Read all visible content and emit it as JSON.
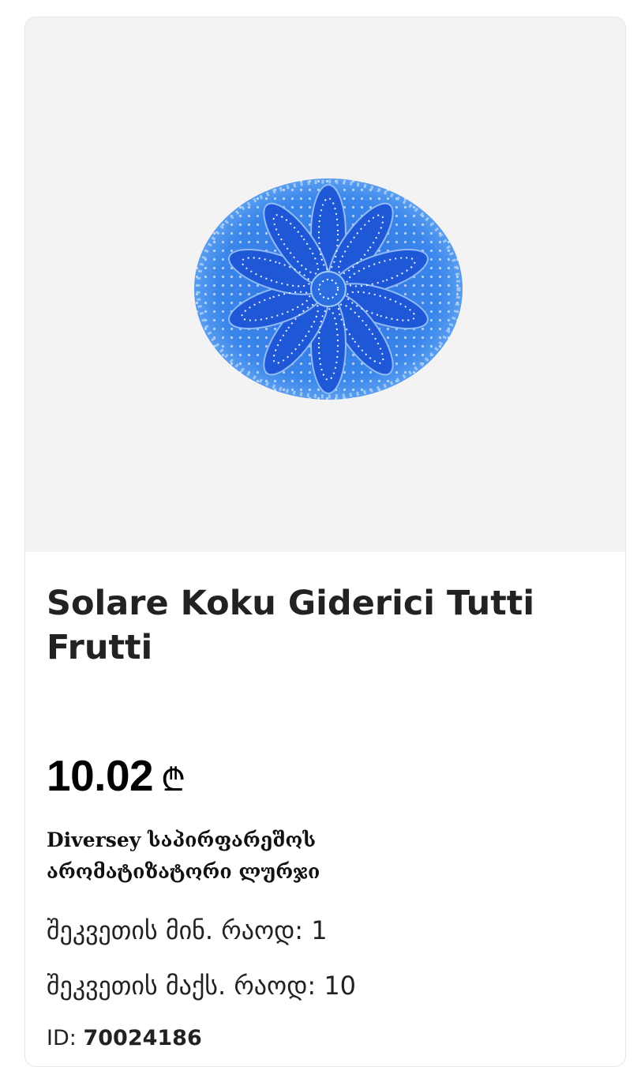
{
  "product": {
    "title": "Solare Koku Giderici Tutti Frutti",
    "price": "10.02",
    "currency_symbol": "₾",
    "subtitle": "Diversey საპირფარეშოს არომატიზატორი ლურჯი",
    "min_order_label": "შეკვეთის მინ. რაოდ:",
    "min_order_value": "1",
    "max_order_label": "შეკვეთის მაქს. რაოდ:",
    "max_order_value": "10",
    "id_label": "ID:",
    "id_value": "70024186",
    "image_icon": "product-image",
    "colors": {
      "image_background": "#f3f3f3",
      "product_blue": "#2f7de8"
    }
  }
}
